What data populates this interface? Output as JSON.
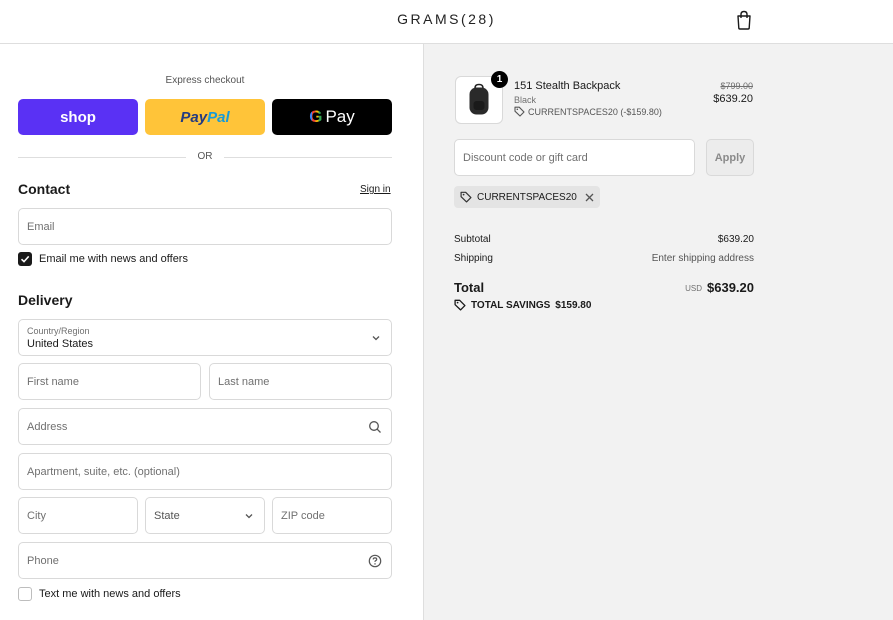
{
  "header": {
    "brand": "GRAMS(28)",
    "cart_icon": "shopping-bag-icon"
  },
  "express": {
    "label": "Express checkout",
    "shop_label": "shop",
    "paypal_a": "Pay",
    "paypal_b": "Pal",
    "gpay_g": "G",
    "gpay_label": "Pay",
    "or_label": "OR",
    "colors": {
      "shop": "#5a31f4",
      "paypal": "#ffc439",
      "gpay": "#000000"
    }
  },
  "contact": {
    "title": "Contact",
    "signin_label": "Sign in",
    "email_placeholder": "Email",
    "email_value": "",
    "newsletter_label": "Email me with news and offers",
    "newsletter_checked": true
  },
  "delivery": {
    "title": "Delivery",
    "country_label": "Country/Region",
    "country_value": "United States",
    "first_name_placeholder": "First name",
    "last_name_placeholder": "Last name",
    "address_placeholder": "Address",
    "apartment_placeholder": "Apartment, suite, etc. (optional)",
    "city_placeholder": "City",
    "state_placeholder": "State",
    "zip_placeholder": "ZIP code",
    "phone_placeholder": "Phone",
    "sms_label": "Text me with news and offers",
    "sms_checked": false
  },
  "order": {
    "quantity": "1",
    "product_name": "151 Stealth Backpack",
    "variant": "Black",
    "discount_line": "CURRENTSPACES20 (-$159.80)",
    "original_price": "$799.00",
    "price": "$639.20",
    "discount_placeholder": "Discount code or gift card",
    "apply_label": "Apply",
    "applied_code": "CURRENTSPACES20",
    "subtotal_label": "Subtotal",
    "subtotal_value": "$639.20",
    "shipping_label": "Shipping",
    "shipping_value": "Enter shipping address",
    "total_label": "Total",
    "currency": "USD",
    "total_value": "$639.20",
    "savings_label": "TOTAL SAVINGS",
    "savings_value": "$159.80"
  }
}
